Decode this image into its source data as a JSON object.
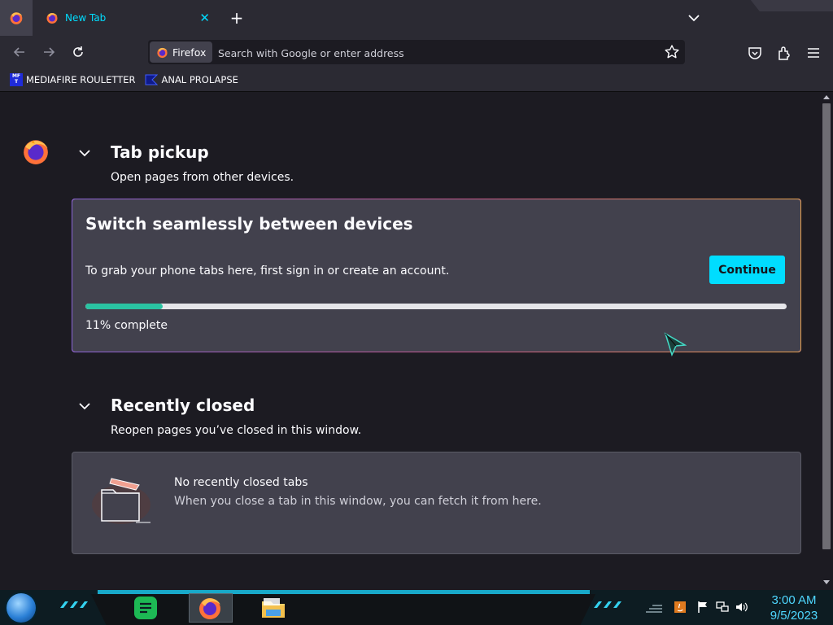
{
  "tabs": [
    {
      "title": "New Tab",
      "active": true
    }
  ],
  "toolbar": {
    "identity_label": "Firefox",
    "url_placeholder": "Search with Google or enter address"
  },
  "bookmarks": [
    {
      "favicon_text": "MF T",
      "label": "MEDIAFIRE ROULETTER"
    },
    {
      "favicon_text": "",
      "label": "ANAL PROLAPSE"
    }
  ],
  "tab_pickup": {
    "heading": "Tab pickup",
    "subheading": "Open pages from other devices.",
    "card_title": "Switch seamlessly between devices",
    "card_message": "To grab your phone tabs here, first sign in or create an account.",
    "continue_label": "Continue",
    "progress_percent": 11,
    "progress_label": "11% complete"
  },
  "recently_closed": {
    "heading": "Recently closed",
    "subheading": "Reopen pages you’ve closed in this window.",
    "empty_title": "No recently closed tabs",
    "empty_message": "When you close a tab in this window, you can fetch it from here."
  },
  "taskbar": {
    "clock_time": "3:00 AM",
    "clock_date": "9/5/2023"
  },
  "colors": {
    "accent": "#00ddff",
    "progress_fill": "#2ac3a2",
    "card_bg": "#42414d",
    "page_bg": "#1c1b22"
  },
  "icons": [
    "firefox-icon",
    "close-icon",
    "plus-icon",
    "chevron-down-icon",
    "back-icon",
    "forward-icon",
    "reload-icon",
    "star-icon",
    "pocket-icon",
    "extensions-icon",
    "menu-icon",
    "folder-icon",
    "cursor-icon",
    "notes-icon",
    "file-explorer-icon",
    "flag-icon",
    "network-icon",
    "volume-icon"
  ]
}
